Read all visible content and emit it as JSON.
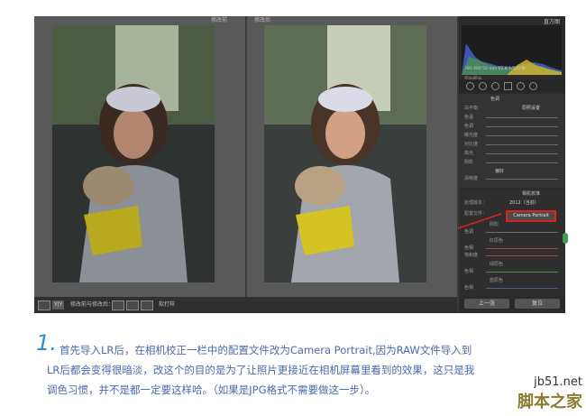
{
  "app": {
    "tabs": {
      "before": "修改前",
      "after": "修改后"
    },
    "bottom_bar": {
      "view_badge": "Y|Y",
      "label": "修改前与修改后：",
      "soft_proof": "软打样"
    },
    "panel": {
      "histogram_title": "直方图",
      "histogram_readout": "ISO 400   50 mm   f/2.8   1/125 秒",
      "original_photo_label": "原始照片",
      "basic_section_title": "色调",
      "basic_rows": [
        "白平衡",
        "色温",
        "色调",
        "曝光度",
        "对比度",
        "高光",
        "阴影"
      ],
      "wb_value": "原照设置",
      "presence_title": "偏好",
      "presence_rows": [
        "清晰度",
        "鲜艳度"
      ],
      "calibration_title": "相机校准",
      "process_label": "处理版本：",
      "process_value": "2012（当前）",
      "profile_label": "配置文件：",
      "profile_value": "Camera Portrait",
      "shadows_label": "阴影",
      "shadows_row": "色调",
      "red_label": "红原色",
      "blue_label": "蓝原色",
      "green_label": "绿原色",
      "hue_label": "色相",
      "sat_label": "饱和度",
      "prev_button": "上一张",
      "reset_button": "复位"
    },
    "colors": {
      "highlight_red": "#e0201e",
      "caption_blue": "#4a6aa8"
    }
  },
  "caption": {
    "number": "1.",
    "line1": "首先导入LR后，在相机校正一栏中的配置文件改为Camera Portrait,因为RAW文件导入到",
    "line2": "LR后都会变得很暗淡，改这个的目的是为了让照片更接近在相机屏幕里看到的效果，这只是我",
    "line3": "调色习惯，并不是都一定要这样哈。（如果是JPG格式不需要做这一步）。"
  },
  "watermark": {
    "site": "jb51.net",
    "name": "脚本之家"
  }
}
